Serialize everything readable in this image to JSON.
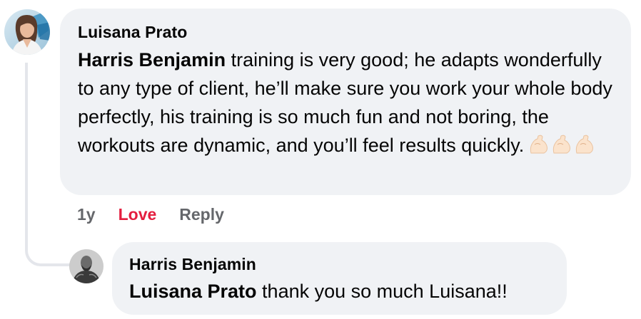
{
  "comment": {
    "author": "Luisana Prato",
    "mention": "Harris Benjamin",
    "text": " training is very good; he adapts wonderfully to any type of client, he’ll make sure you work your whole body perfectly, his training is so much fun and not boring, the workouts are dynamic, and you’ll feel results quickly.",
    "emojis": [
      "flexed-biceps-emoji",
      "flexed-biceps-emoji",
      "flexed-biceps-emoji"
    ],
    "timestamp": "1y",
    "reaction_label": "Love",
    "reply_label": "Reply"
  },
  "reply": {
    "author": "Harris Benjamin",
    "mention": "Luisana Prato",
    "text": " thank you so much Luisana!!"
  },
  "colors": {
    "bubble": "#f0f2f5",
    "text": "#050505",
    "secondary": "#65676b",
    "love": "#e41e3f",
    "thread_line": "#e4e6eb"
  }
}
